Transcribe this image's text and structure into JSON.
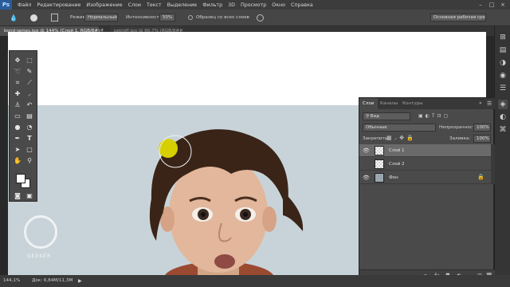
{
  "app": {
    "logo": "Ps"
  },
  "menu": [
    "Файл",
    "Редактирование",
    "Изображение",
    "Слои",
    "Текст",
    "Выделение",
    "Фильтр",
    "3D",
    "Просмотр",
    "Окно",
    "Справка"
  ],
  "options": {
    "mode_label": "Режим:",
    "mode_value": "Нормальный",
    "intensity_label": "Интенсивность:",
    "intensity_value": "50%",
    "sample_all_label": "Образец со всех слоев",
    "workspace": "Основная рабочая среда"
  },
  "tabs": [
    {
      "label": "bond-james.jpg @ 144% (Слой 1, RGB/8#) *"
    },
    {
      "label": "petroff.jpg @ 66,7% (RGB/8#)"
    }
  ],
  "panel": {
    "tabs": [
      "Слои",
      "Каналы",
      "Контуры"
    ],
    "filter_label": "Вид",
    "blend_mode": "Обычные",
    "opacity_label": "Непрозрачность:",
    "opacity_value": "100%",
    "lock_label": "Закрепить:",
    "fill_label": "Заливка:",
    "fill_value": "100%",
    "layers": [
      {
        "name": "Слой 1",
        "visible": true,
        "selected": true
      },
      {
        "name": "Слой 2",
        "visible": false,
        "selected": false
      },
      {
        "name": "Фон",
        "visible": true,
        "selected": false,
        "locked": true
      }
    ]
  },
  "status": {
    "zoom": "144,1%",
    "doc": "Док: 6,84М/11,3М"
  },
  "watermark": "GEEKER",
  "colors": {
    "accent": "#2a5c9a",
    "brush": "#d7d000"
  }
}
